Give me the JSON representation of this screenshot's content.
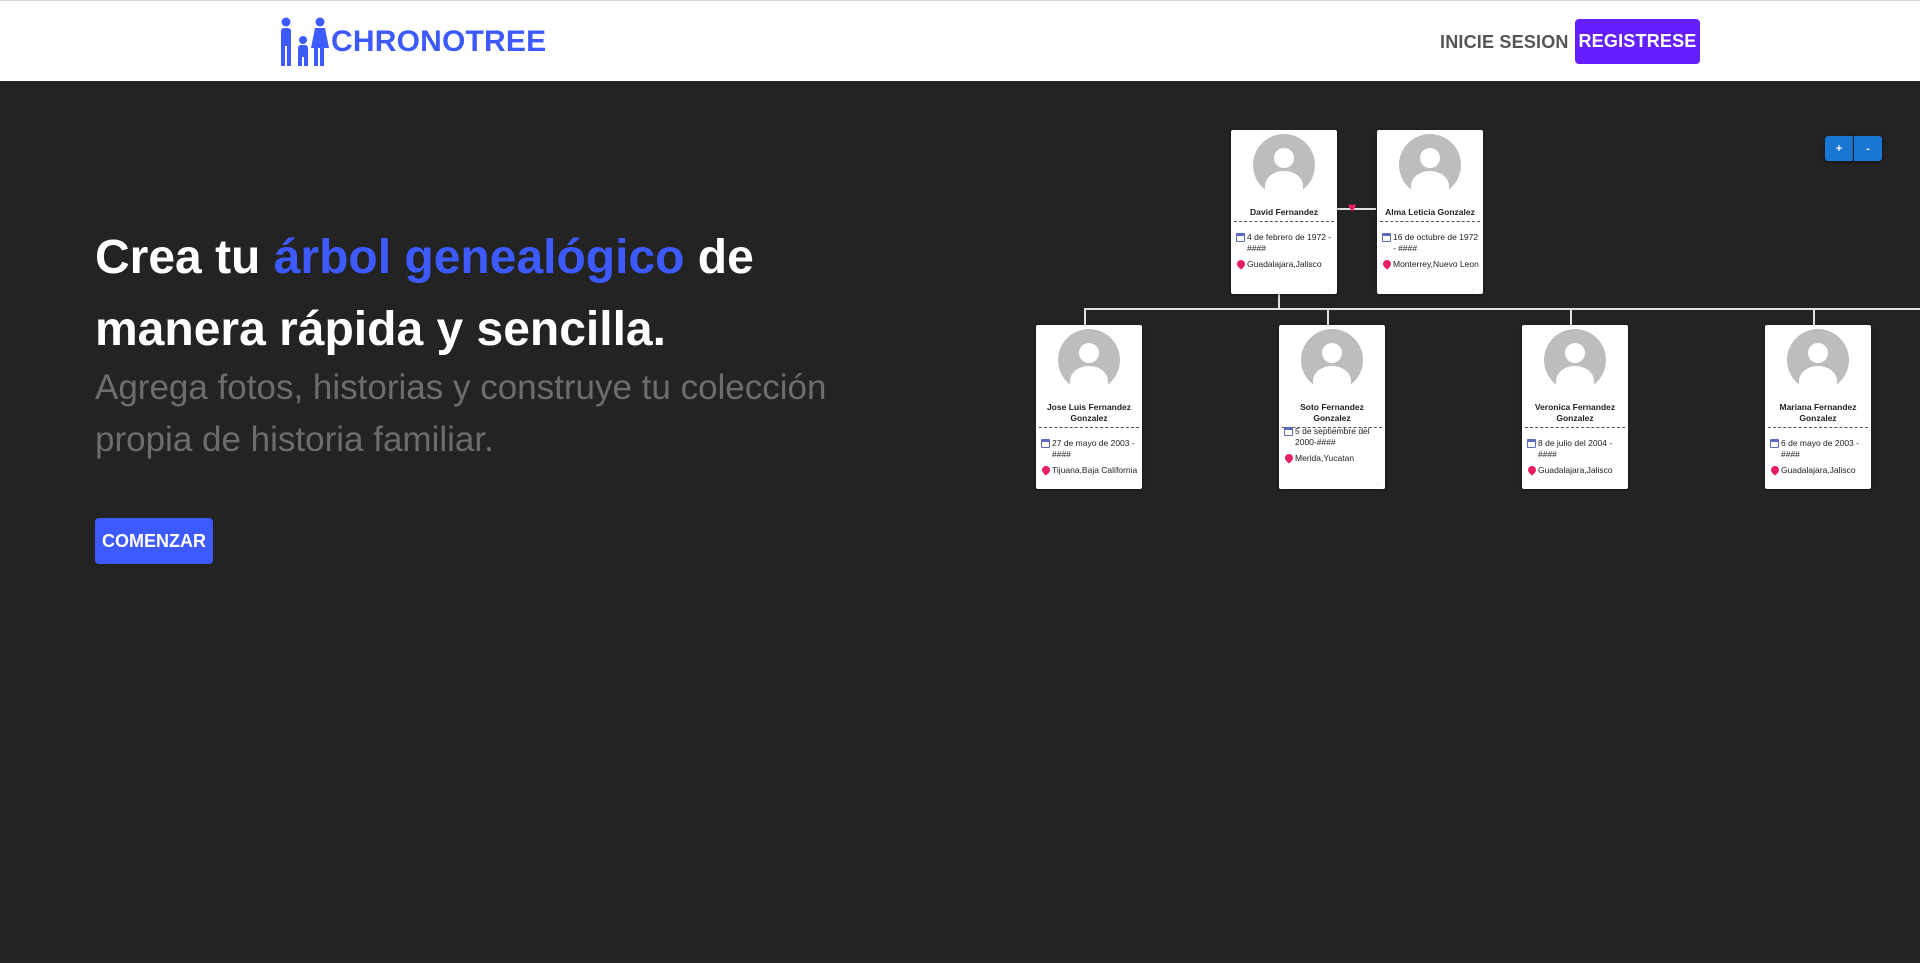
{
  "nav": {
    "brand": "CHRONOTREE",
    "login": "INICIE SESION",
    "register": "REGISTRESE"
  },
  "hero": {
    "title_part1": "Crea tu ",
    "title_accent": "árbol genealógico",
    "title_part2": " de manera rápida y sencilla.",
    "subtitle": "Agrega fotos, historias y construye tu colección propia de historia familiar.",
    "cta": "COMENZAR"
  },
  "zoom": {
    "in": "+",
    "out": "-"
  },
  "tree": {
    "parents": [
      {
        "name": "David Fernandez",
        "date": "4 de febrero de 1972 - ####",
        "place": "Guadalajara,Jalisco"
      },
      {
        "name": "Alma Leticia Gonzalez",
        "date": "16 de octubre de 1972 - ####",
        "place": "Monterrey,Nuevo Leon"
      }
    ],
    "children": [
      {
        "name": "Jose Luis Fernandez Gonzalez",
        "date": "27 de mayo de 2003 - ####",
        "place": "Tijuana,Baja California"
      },
      {
        "name": "Soto Fernandez Gonzalez",
        "date": "5 de septiembre del 2000-####",
        "place": "Merida,Yucatan"
      },
      {
        "name": "Veronica Fernandez Gonzalez",
        "date": "8 de julio del 2004 - ####",
        "place": "Guadalajara,Jalisco"
      },
      {
        "name": "Mariana Fernandez Gonzalez",
        "date": "6 de mayo de 2003 - ####",
        "place": "Guadalajara,Jalisco"
      }
    ]
  },
  "colors": {
    "brand": "#3d5afe",
    "register": "#651fff",
    "background": "#232323",
    "zoom": "#1976d2",
    "heart": "#e91e63"
  },
  "icons": [
    "family-logo-icon",
    "avatar-icon",
    "calendar-icon",
    "location-pin-icon",
    "heart-icon"
  ]
}
